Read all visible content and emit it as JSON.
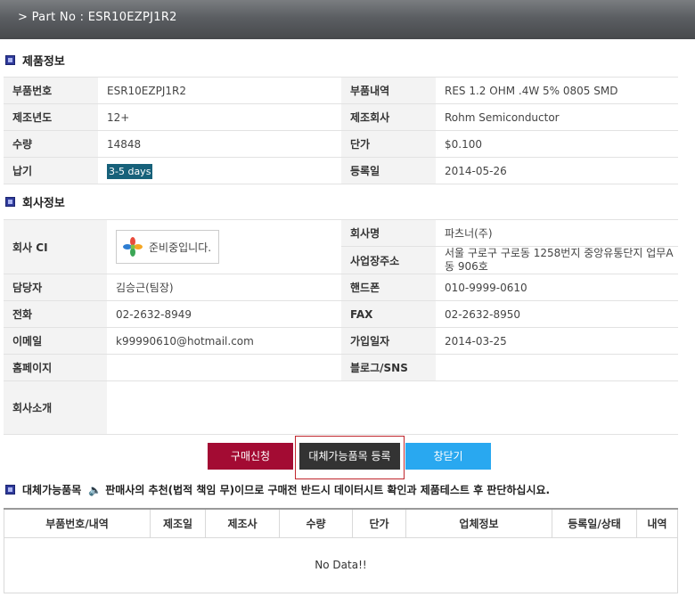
{
  "header": {
    "title": "> Part No : ESR10EZPJ1R2"
  },
  "product_section": {
    "title": "제품정보"
  },
  "product": {
    "part_no_label": "부품번호",
    "part_no": "ESR10EZPJ1R2",
    "desc_label": "부품내역",
    "desc": "RES 1.2 OHM .4W 5% 0805 SMD",
    "year_label": "제조년도",
    "year": "12+",
    "maker_label": "제조회사",
    "maker": "Rohm Semiconductor",
    "qty_label": "수량",
    "qty": "14848",
    "price_label": "단가",
    "price": "$0.100",
    "delivery_label": "납기",
    "delivery": "3-5 days",
    "regdate_label": "등록일",
    "regdate": "2014-05-26"
  },
  "company_section": {
    "title": "회사정보"
  },
  "company": {
    "ci_label": "회사 CI",
    "ci_placeholder": "준비중입니다.",
    "name_label": "회사명",
    "name": "파츠너(주)",
    "address_label": "사업장주소",
    "address": "서울 구로구 구로동 1258번지 중앙유통단지 업무A동 906호",
    "manager_label": "담당자",
    "manager": "김승근(팀장)",
    "mobile_label": "핸드폰",
    "mobile": "010-9999-0610",
    "phone_label": "전화",
    "phone": "02-2632-8949",
    "fax_label": "FAX",
    "fax": "02-2632-8950",
    "email_label": "이메일",
    "email": "k99990610@hotmail.com",
    "joined_label": "가입일자",
    "joined": "2014-03-25",
    "homepage_label": "홈페이지",
    "homepage": "",
    "blog_label": "블로그/SNS",
    "blog": "",
    "intro_label": "회사소개",
    "intro": ""
  },
  "buttons": {
    "purchase": "구매신청",
    "register_alt": "대체가능품목 등록",
    "close": "창닫기"
  },
  "alternatives": {
    "title": "대체가능품목",
    "notice": "판매사의 추천(법적 책임 무)이므로 구매전 반드시 데이터시트 확인과 제품테스트 후 판단하십시요.",
    "columns": [
      "부품번호/내역",
      "제조일",
      "제조사",
      "수량",
      "단가",
      "업체정보",
      "등록일/상태",
      "내역"
    ],
    "empty": "No Data!!"
  },
  "colors": {
    "header_bg": "#5b5e62",
    "purchase": "#a30b33",
    "register": "#333333",
    "close": "#29a8f0",
    "badge": "#17617a"
  }
}
